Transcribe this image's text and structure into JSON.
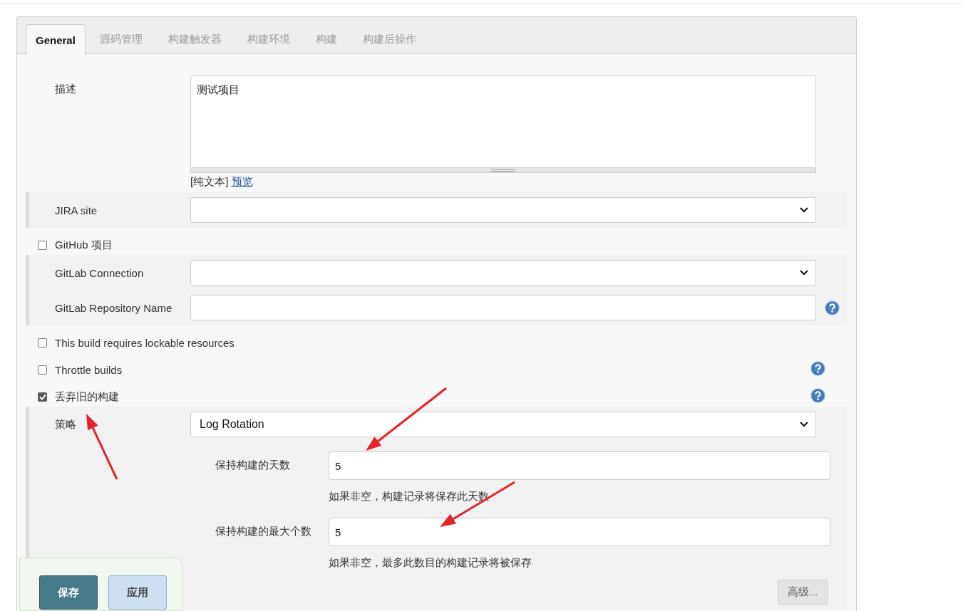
{
  "tabs": [
    {
      "label": "General",
      "selected": true
    },
    {
      "label": "源码管理",
      "selected": false
    },
    {
      "label": "构建触发器",
      "selected": false
    },
    {
      "label": "构建环境",
      "selected": false
    },
    {
      "label": "构建",
      "selected": false
    },
    {
      "label": "构建后操作",
      "selected": false
    }
  ],
  "description": {
    "label": "描述",
    "value": "测试项目",
    "format_note": "[纯文本]",
    "preview_link": "预览"
  },
  "rows": [
    {
      "kind": "group",
      "fields": [
        {
          "kind": "select",
          "label": "JIRA site",
          "help": false
        }
      ]
    },
    {
      "kind": "checkbox",
      "label": "GitHub 项目",
      "checked": false,
      "help": false
    },
    {
      "kind": "group",
      "fields": [
        {
          "kind": "select",
          "label": "GitLab Connection",
          "help": false
        },
        {
          "kind": "text",
          "label": "GitLab Repository Name",
          "help": true
        }
      ]
    },
    {
      "kind": "checkbox",
      "label": "This build requires lockable resources",
      "checked": false,
      "help": false
    },
    {
      "kind": "checkbox",
      "label": "Throttle builds",
      "checked": false,
      "help": true
    },
    {
      "kind": "checkbox",
      "label": "丢弃旧的构建",
      "checked": true,
      "help": true
    },
    {
      "kind": "group",
      "fields": [
        {
          "kind": "select",
          "label": "策略",
          "value": "Log Rotation",
          "help": false
        },
        {
          "kind": "sub",
          "label": "保持构建的天数",
          "value": "5",
          "hint": "如果非空，构建记录将保存此天数"
        },
        {
          "kind": "sub",
          "label": "保持构建的最大个数",
          "value": "5",
          "hint": "如果非空，最多此数目的构建记录将被保存"
        }
      ],
      "advanced_button": "高级..."
    }
  ],
  "buttons": [
    {
      "label": "保存",
      "kind": "primary"
    },
    {
      "label": "应用",
      "kind": "secondary"
    }
  ]
}
